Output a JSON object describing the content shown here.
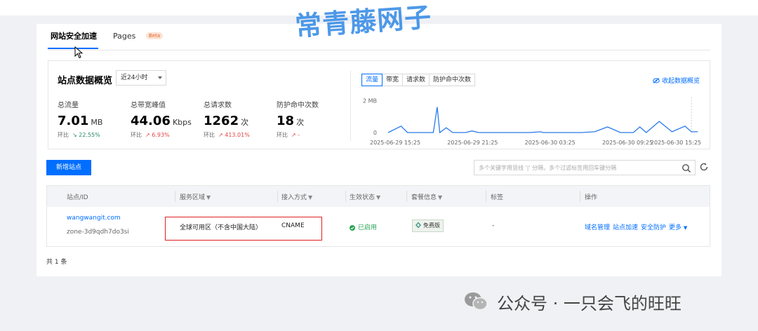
{
  "watermark_top": "常青藤网子",
  "tabs": [
    {
      "label": "网站安全加速",
      "active": true
    },
    {
      "label": "Pages",
      "badge": "Beta",
      "active": false
    }
  ],
  "overview": {
    "title": "站点数据概览",
    "period": "近24小时",
    "metrics": [
      {
        "label": "总流量",
        "value": "7.01",
        "unit": "MB",
        "compare_label": "环比",
        "compare": "↘ 22.55%",
        "trend": "down"
      },
      {
        "label": "总带宽峰值",
        "value": "44.06",
        "unit": "Kbps",
        "compare_label": "环比",
        "compare": "↗ 6.93%",
        "trend": "up"
      },
      {
        "label": "总请求数",
        "value": "1262",
        "unit": "次",
        "compare_label": "环比",
        "compare": "↗ 413.01%",
        "trend": "up"
      },
      {
        "label": "防护命中次数",
        "value": "18",
        "unit": "次",
        "compare_label": "环比",
        "compare": "↗ -",
        "trend": "up"
      }
    ],
    "segments": [
      "流量",
      "带宽",
      "请求数",
      "防护命中次数"
    ],
    "active_segment": "流量",
    "collapse_label": "收起数据概览"
  },
  "chart_data": {
    "type": "line",
    "series_color": "#2b7bea",
    "y_ticks": [
      "2 MB",
      "0"
    ],
    "x_ticks": [
      "2025-06-29 15:25",
      "2025-06-29 21:25",
      "2025-06-30 03:25",
      "2025-06-30 09:25",
      "2025-06-30 15:25"
    ],
    "ylim": [
      0,
      2.2
    ],
    "x_hours": [
      0,
      1,
      1.5,
      1.7,
      2,
      2.5,
      3,
      3.5,
      3.8,
      4,
      4.5,
      5,
      6,
      6.5,
      7,
      8,
      9,
      10,
      11,
      11.8,
      12,
      13,
      15,
      16,
      17,
      18,
      18.5,
      19,
      19.5,
      20,
      21,
      22,
      23,
      23.5,
      24
    ],
    "values": [
      0,
      0.4,
      0,
      0,
      0,
      0,
      0,
      0,
      1.6,
      0,
      0.3,
      0,
      0,
      0.1,
      0,
      0,
      0,
      0,
      0,
      0.05,
      0,
      0,
      0,
      0.05,
      0.35,
      0,
      0,
      0,
      0.35,
      0,
      0.7,
      0.05,
      0.4,
      0.05,
      0.05
    ],
    "xlim": [
      -0.6,
      24.2
    ]
  },
  "toolbar": {
    "add_label": "新增站点",
    "search_placeholder": "多个关键字用竖线 '|' 分隔，多个过滤标签用回车键分隔"
  },
  "table": {
    "headers": [
      "站点/ID",
      "服务区域",
      "接入方式",
      "生效状态",
      "套餐信息",
      "标签",
      "操作"
    ],
    "rows": [
      {
        "site": "wangwangit.com",
        "zone_id": "zone-3d9qdh7do3si",
        "region": "全球可用区（不含中国大陆）",
        "access": "CNAME",
        "status": "已启用",
        "package": "免费版",
        "tags": "-",
        "actions": [
          "域名管理",
          "站点加速",
          "安全防护",
          "更多"
        ]
      }
    ]
  },
  "total_label": "共 1 条",
  "wechat_label": "公众号 · 一只会飞的旺旺"
}
